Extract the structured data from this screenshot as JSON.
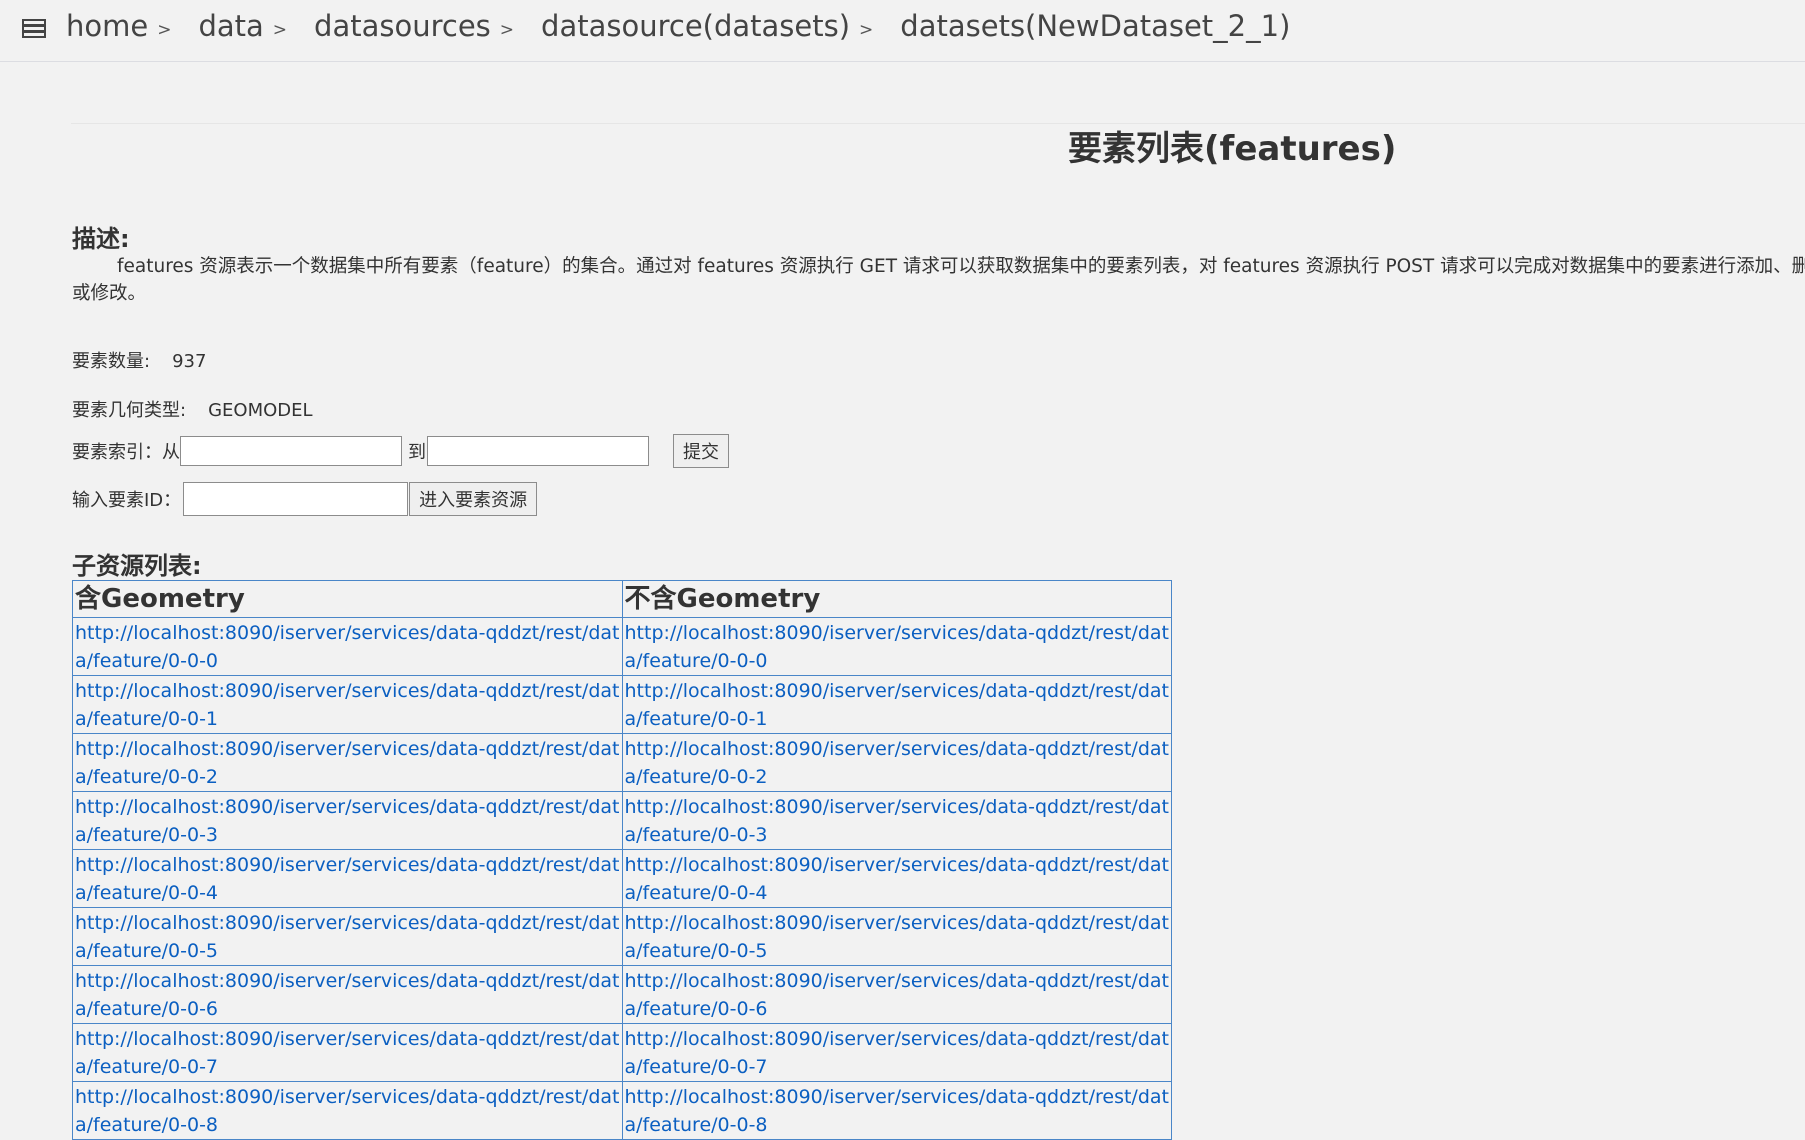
{
  "breadcrumb": {
    "icon": "menu-icon",
    "items": [
      {
        "label": "home"
      },
      {
        "label": "data"
      },
      {
        "label": "datasources"
      },
      {
        "label": "datasource(datasets)"
      },
      {
        "label": "datasets(NewDataset_2_1)"
      }
    ],
    "separator": ">"
  },
  "page": {
    "title": "要素列表(features)"
  },
  "description": {
    "heading": "描述:",
    "text": "features 资源表示一个数据集中所有要素（feature）的集合。通过对 features 资源执行 GET 请求可以获取数据集中的要素列表，对 features 资源执行 POST 请求可以完成对数据集中的要素进行添加、删除或修改。"
  },
  "info": {
    "count_label": "要素数量:",
    "count_value": "937",
    "geom_label": "要素几何类型:",
    "geom_value": "GEOMODEL"
  },
  "range_form": {
    "label": "要素索引：从",
    "to_label": "到",
    "from_value": "",
    "to_value": "",
    "submit_label": "提交"
  },
  "id_form": {
    "label": "输入要素ID：",
    "value": "",
    "button_label": "进入要素资源"
  },
  "child_resources": {
    "heading": "子资源列表:",
    "col_with_geometry": "含Geometry",
    "col_without_geometry": "不含Geometry",
    "rows": [
      {
        "with": "http://localhost:8090/iserver/services/data-qddzt/rest/data/feature/0-0-0",
        "without": "http://localhost:8090/iserver/services/data-qddzt/rest/data/feature/0-0-0"
      },
      {
        "with": "http://localhost:8090/iserver/services/data-qddzt/rest/data/feature/0-0-1",
        "without": "http://localhost:8090/iserver/services/data-qddzt/rest/data/feature/0-0-1"
      },
      {
        "with": "http://localhost:8090/iserver/services/data-qddzt/rest/data/feature/0-0-2",
        "without": "http://localhost:8090/iserver/services/data-qddzt/rest/data/feature/0-0-2"
      },
      {
        "with": "http://localhost:8090/iserver/services/data-qddzt/rest/data/feature/0-0-3",
        "without": "http://localhost:8090/iserver/services/data-qddzt/rest/data/feature/0-0-3"
      },
      {
        "with": "http://localhost:8090/iserver/services/data-qddzt/rest/data/feature/0-0-4",
        "without": "http://localhost:8090/iserver/services/data-qddzt/rest/data/feature/0-0-4"
      },
      {
        "with": "http://localhost:8090/iserver/services/data-qddzt/rest/data/feature/0-0-5",
        "without": "http://localhost:8090/iserver/services/data-qddzt/rest/data/feature/0-0-5"
      },
      {
        "with": "http://localhost:8090/iserver/services/data-qddzt/rest/data/feature/0-0-6",
        "without": "http://localhost:8090/iserver/services/data-qddzt/rest/data/feature/0-0-6"
      },
      {
        "with": "http://localhost:8090/iserver/services/data-qddzt/rest/data/feature/0-0-7",
        "without": "http://localhost:8090/iserver/services/data-qddzt/rest/data/feature/0-0-7"
      },
      {
        "with": "http://localhost:8090/iserver/services/data-qddzt/rest/data/feature/0-0-8",
        "without": "http://localhost:8090/iserver/services/data-qddzt/rest/data/feature/0-0-8"
      }
    ]
  }
}
